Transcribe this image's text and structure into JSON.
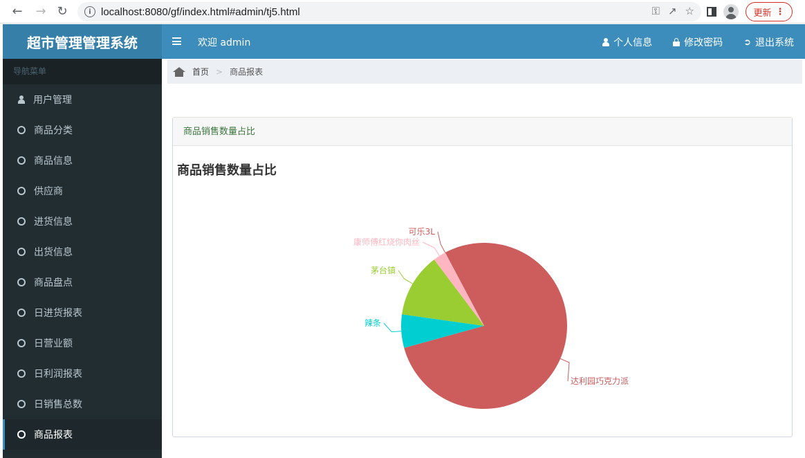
{
  "browser": {
    "url": "localhost:8080/gf/index.html#admin/tj5.html",
    "update_label": "更新"
  },
  "header": {
    "app_title": "超市管理管理系统",
    "welcome": "欢迎 admin",
    "profile_label": "个人信息",
    "password_label": "修改密码",
    "logout_label": "退出系统"
  },
  "sidebar": {
    "section_label": "导航菜单",
    "items": [
      {
        "label": "用户管理"
      },
      {
        "label": "商品分类"
      },
      {
        "label": "商品信息"
      },
      {
        "label": "供应商"
      },
      {
        "label": "进货信息"
      },
      {
        "label": "出货信息"
      },
      {
        "label": "商品盘点"
      },
      {
        "label": "日进货报表"
      },
      {
        "label": "日营业额"
      },
      {
        "label": "日利润报表"
      },
      {
        "label": "日销售总数"
      },
      {
        "label": "商品报表"
      }
    ]
  },
  "breadcrumb": {
    "home": "首页",
    "separator": ">",
    "current": "商品报表"
  },
  "panel": {
    "heading": "商品销售数量占比"
  },
  "chart_data": {
    "type": "pie",
    "title": "商品销售数量占比",
    "slices": [
      {
        "name": "达利园巧克力派",
        "value": 78.5,
        "color": "#cd5c5c"
      },
      {
        "name": "辣条",
        "value": 6.5,
        "color": "#00ced1"
      },
      {
        "name": "茅台镇",
        "value": 12.5,
        "color": "#9acd32"
      },
      {
        "name": "康师傅红烧你肉丝",
        "value": 2.5,
        "color": "#ffb6c1"
      },
      {
        "name": "可乐3L",
        "value": 0,
        "color": "#cd5c5c"
      }
    ]
  }
}
